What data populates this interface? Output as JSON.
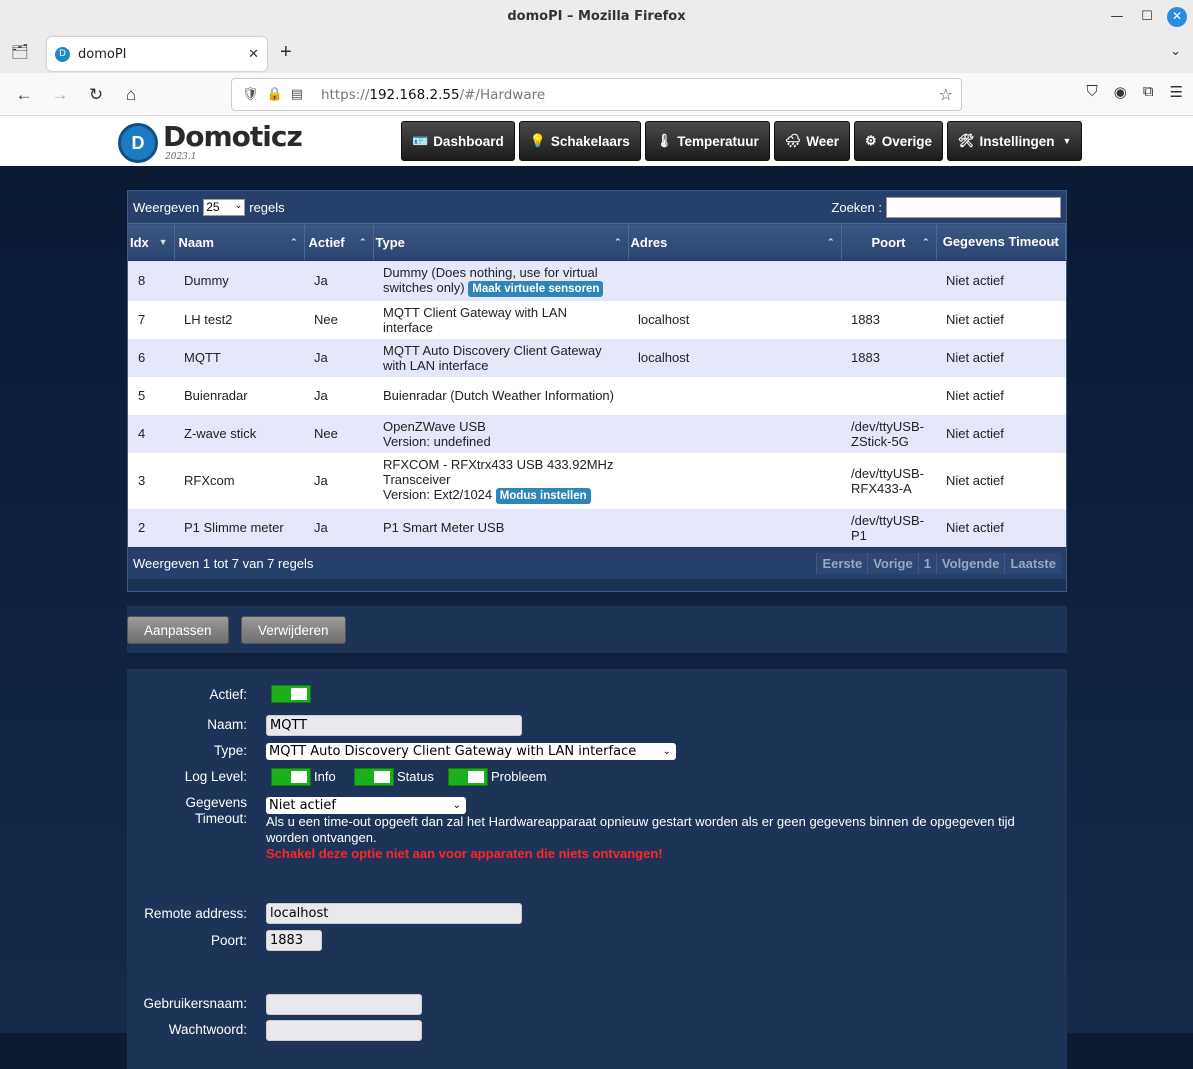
{
  "window": {
    "title": "domoPI – Mozilla Firefox"
  },
  "browser": {
    "tab_title": "domoPI",
    "url_prefix": "https://",
    "url_host": "192.168.2.55",
    "url_path": "/#/Hardware"
  },
  "app": {
    "logo_text": "Domoticz",
    "version": "2023.1",
    "nav": [
      {
        "label": "Dashboard",
        "icon": "dashboard-icon"
      },
      {
        "label": "Schakelaars",
        "icon": "lightbulb-icon"
      },
      {
        "label": "Temperatuur",
        "icon": "thermometer-icon"
      },
      {
        "label": "Weer",
        "icon": "weather-icon"
      },
      {
        "label": "Overige",
        "icon": "utility-icon"
      },
      {
        "label": "Instellingen",
        "icon": "tools-icon"
      }
    ]
  },
  "table": {
    "show_prefix": "Weergeven",
    "show_value": "25",
    "show_suffix": "regels",
    "search_label": "Zoeken :",
    "columns": [
      "Idx",
      "Naam",
      "Actief",
      "Type",
      "Adres",
      "Poort",
      "Gegevens Timeout"
    ],
    "rows": [
      {
        "idx": "8",
        "naam": "Dummy",
        "actief": "Ja",
        "type": "Dummy (Does nothing, use for virtual switches only)",
        "button": "Maak virtuele sensoren",
        "adres": "",
        "poort": "",
        "timeout": "Niet actief"
      },
      {
        "idx": "7",
        "naam": "LH test2",
        "actief": "Nee",
        "type": "MQTT Client Gateway with LAN interface",
        "button": "",
        "adres": "localhost",
        "poort": "1883",
        "timeout": "Niet actief"
      },
      {
        "idx": "6",
        "naam": "MQTT",
        "actief": "Ja",
        "type": "MQTT Auto Discovery Client Gateway with LAN interface",
        "button": "",
        "adres": "localhost",
        "poort": "1883",
        "timeout": "Niet actief"
      },
      {
        "idx": "5",
        "naam": "Buienradar",
        "actief": "Ja",
        "type": "Buienradar (Dutch Weather Information)",
        "button": "",
        "adres": "",
        "poort": "",
        "timeout": "Niet actief"
      },
      {
        "idx": "4",
        "naam": "Z-wave stick",
        "actief": "Nee",
        "type": "OpenZWave USB",
        "type2": "Version: undefined",
        "button": "",
        "adres": "",
        "poort": "/dev/ttyUSB-ZStick-5G",
        "timeout": "Niet actief"
      },
      {
        "idx": "3",
        "naam": "RFXcom",
        "actief": "Ja",
        "type": "RFXCOM - RFXtrx433 USB 433.92MHz Transceiver",
        "type2": "Version: Ext2/1024",
        "button": "Modus instellen",
        "adres": "",
        "poort": "/dev/ttyUSB-RFX433-A",
        "timeout": "Niet actief"
      },
      {
        "idx": "2",
        "naam": "P1 Slimme meter",
        "actief": "Ja",
        "type": "P1 Smart Meter USB",
        "button": "",
        "adres": "",
        "poort": "/dev/ttyUSB-P1",
        "timeout": "Niet actief"
      }
    ],
    "info": "Weergeven 1 tot 7 van 7 regels",
    "pager": [
      "Eerste",
      "Vorige",
      "1",
      "Volgende",
      "Laatste"
    ]
  },
  "actions": {
    "edit": "Aanpassen",
    "delete": "Verwijderen"
  },
  "form": {
    "active_label": "Actief:",
    "name_label": "Naam:",
    "name_value": "MQTT",
    "type_label": "Type:",
    "type_value": "MQTT Auto Discovery Client Gateway with LAN interface",
    "loglevel_label": "Log Level:",
    "log_info": "Info",
    "log_status": "Status",
    "log_error": "Probleem",
    "timeout_label_1": "Gegevens",
    "timeout_label_2": "Timeout:",
    "timeout_value": "Niet actief",
    "timeout_help": "Als u een time-out opgeeft dan zal het Hardwareapparaat opnieuw gestart worden als er geen gegevens binnen de opgegeven tijd worden ontvangen.",
    "timeout_warning": "Schakel deze optie niet aan voor apparaten die niets ontvangen!",
    "remote_label": "Remote address:",
    "remote_value": "localhost",
    "port_label": "Poort:",
    "port_value": "1883",
    "user_label": "Gebruikersnaam:",
    "password_label": "Wachtwoord:"
  }
}
